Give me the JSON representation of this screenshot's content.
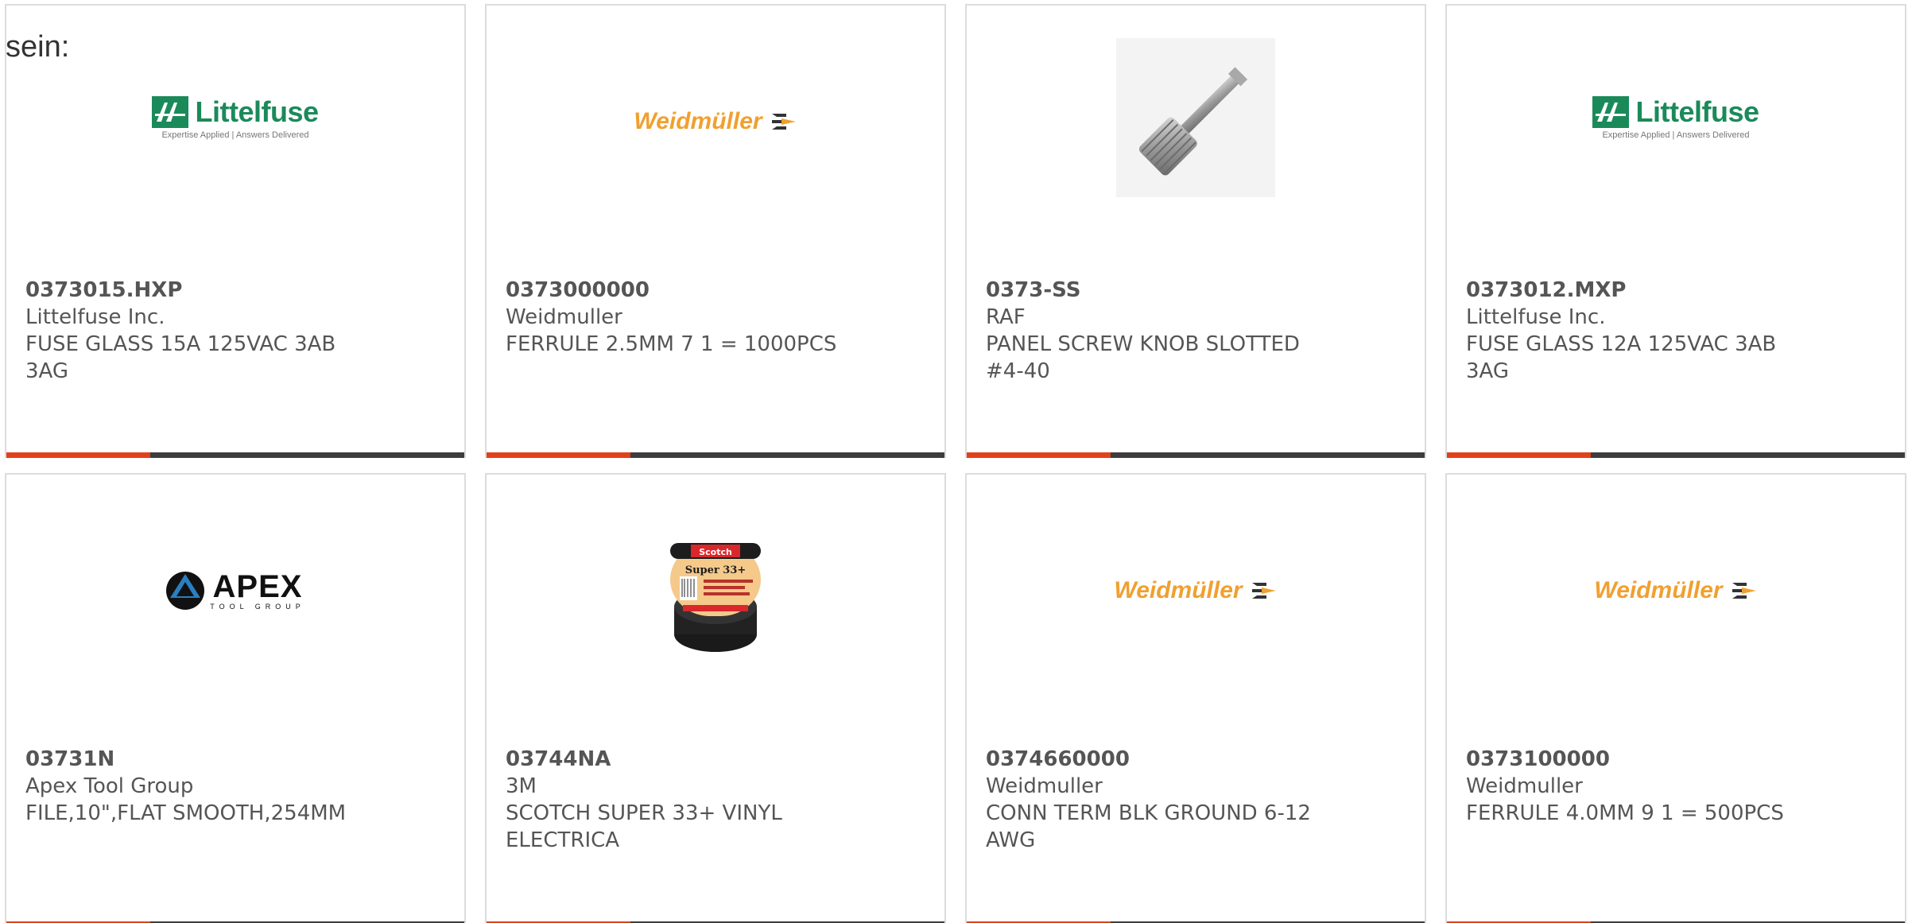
{
  "intro_text": "sein:",
  "colors": {
    "accent": "#e2401c",
    "bar": "#3d3d3d",
    "text": "#555555",
    "border": "#dcdcdc",
    "littelfuse_green": "#1b8a5a",
    "weidmuller_orange": "#f0a030"
  },
  "products": [
    {
      "part_number": "0373015.HXP",
      "manufacturer": "Littelfuse Inc.",
      "description": "FUSE GLASS 15A 125VAC 3AB 3AG",
      "image": "littelfuse-logo",
      "logo_text": "Littelfuse",
      "logo_tagline": "Expertise Applied | Answers Delivered"
    },
    {
      "part_number": "0373000000",
      "manufacturer": "Weidmuller",
      "description": "FERRULE 2.5MM 7 1 = 1000PCS",
      "image": "weidmuller-logo",
      "logo_text": "Weidmüller"
    },
    {
      "part_number": "0373-SS",
      "manufacturer": "RAF",
      "description": "PANEL SCREW KNOB SLOTTED #4-40",
      "image": "panel-screw-photo"
    },
    {
      "part_number": "0373012.MXP",
      "manufacturer": "Littelfuse Inc.",
      "description": "FUSE GLASS 12A 125VAC 3AB 3AG",
      "image": "littelfuse-logo",
      "logo_text": "Littelfuse",
      "logo_tagline": "Expertise Applied | Answers Delivered"
    },
    {
      "part_number": "03731N",
      "manufacturer": "Apex Tool Group",
      "description": "FILE,10\",FLAT SMOOTH,254MM",
      "image": "apex-logo",
      "logo_text": "APEX",
      "logo_tagline": "TOOL GROUP"
    },
    {
      "part_number": "03744NA",
      "manufacturer": "3M",
      "description": "SCOTCH SUPER 33+ VINYL ELECTRICA",
      "image": "electrical-tape-photo",
      "logo_text": "Scotch",
      "logo_tagline": "Super 33+"
    },
    {
      "part_number": "0374660000",
      "manufacturer": "Weidmuller",
      "description": "CONN TERM BLK GROUND 6-12 AWG",
      "image": "weidmuller-logo",
      "logo_text": "Weidmüller"
    },
    {
      "part_number": "0373100000",
      "manufacturer": "Weidmuller",
      "description": "FERRULE 4.0MM 9 1 = 500PCS",
      "image": "weidmuller-logo",
      "logo_text": "Weidmüller"
    }
  ]
}
